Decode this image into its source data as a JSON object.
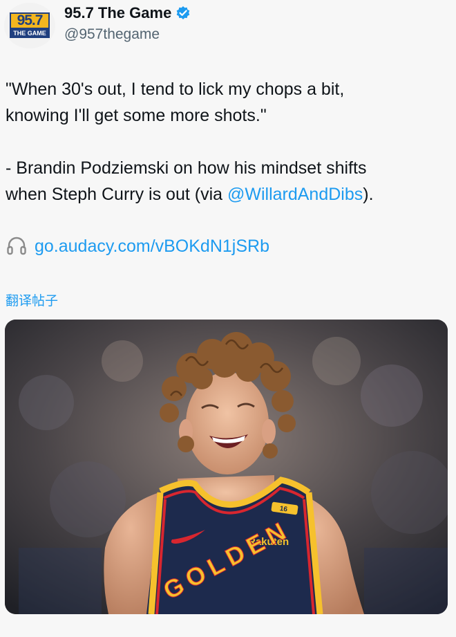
{
  "account": {
    "display_name": "95.7 The Game",
    "handle": "@957thegame",
    "verified_icon": "verified-badge-icon",
    "avatar": {
      "logo_number": "95.7",
      "logo_text": "THE GAME"
    }
  },
  "tweet": {
    "line1": "\"When 30's out, I tend to lick my chops a bit,",
    "line2": "knowing I'll get some more shots.\"",
    "line3": "- Brandin Podziemski on how his mindset shifts",
    "line4_before": "when Steph Curry is out (via ",
    "mention": "@WillardAndDibs",
    "line4_after": ")."
  },
  "link": {
    "icon": "headphones-icon",
    "url": "go.audacy.com/vBOKdN1jSRb"
  },
  "translate_label": "翻译帖子",
  "media": {
    "jersey_text": "GOLDEN",
    "sponsor": "Rakuten",
    "patch_number": "16"
  },
  "colors": {
    "accent": "#1d9bf0",
    "text": "#0f1419",
    "secondary": "#536471",
    "jersey_navy": "#1d2a4d",
    "jersey_gold": "#f6c12d"
  }
}
